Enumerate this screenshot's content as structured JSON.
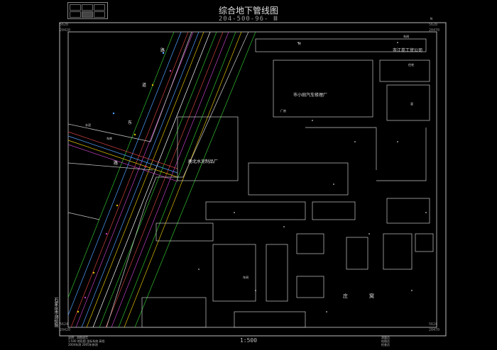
{
  "map": {
    "title": "综合地下管线图",
    "sheet_number": "204-500-96- Ⅲ",
    "scale": "1:500",
    "north_mark": "N",
    "side_text": "石家庄市测绘院",
    "corners": {
      "top_left_x": "5628",
      "top_left_y": "20420",
      "top_right_x": "5628",
      "top_right_y": "20470",
      "bottom_left_x": "5624",
      "bottom_left_y": "20420",
      "bottom_right_x": "5624",
      "bottom_right_y": "20470"
    },
    "notes_left": [
      "说明：测图规范",
      "1:500 地形图 坐标系统 高程",
      "2004年测 2005年修测"
    ],
    "notes_right": [
      "测量员",
      "绘图员",
      "检查员"
    ],
    "labels": {
      "factory_cement": "鹿北水泥制品厂",
      "factory_auto": "市小田汽车修理厂",
      "company_trade": "市江蕊工贸公司",
      "village_chars": [
        "庄",
        "窝"
      ],
      "road_chars": [
        "东",
        "路"
      ],
      "road_chars2": [
        "路",
        "道",
        "二"
      ],
      "misc": [
        "车间",
        "住宅",
        "砖",
        "混",
        "厂房",
        "车间",
        "水泥",
        "车库"
      ]
    }
  }
}
